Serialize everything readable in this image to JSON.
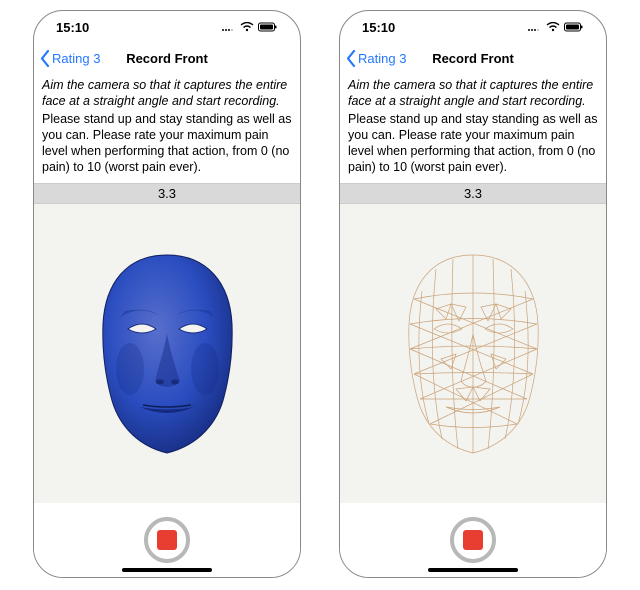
{
  "status": {
    "time": "15:10"
  },
  "header": {
    "back_label": "Rating 3",
    "title": "Record Front"
  },
  "instructions": {
    "italic": "Aim the camera so that it captures the entire face at a straight angle and start recording.",
    "body": "Please stand up and stay standing as well as you can.  Please rate your maximum pain level when performing that action, from 0 (no pain) to 10 (worst pain ever)."
  },
  "rating_value": "3.3",
  "face": {
    "left_mode": "solid",
    "right_mode": "wireframe",
    "solid_color": "#2a4dc0",
    "wire_color": "#c79a6a"
  }
}
